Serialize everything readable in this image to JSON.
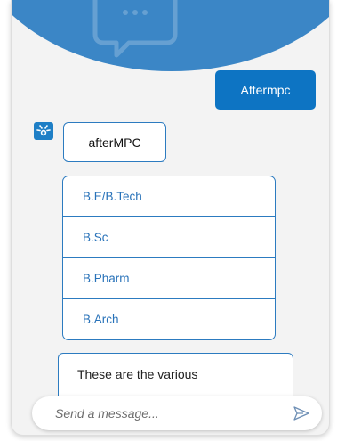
{
  "colors": {
    "header": "#3b86c6",
    "user_bubble": "#0d74c3",
    "bot_border": "#2c7bc0",
    "option_text": "#2872b9",
    "background": "#f3f3f3"
  },
  "header": {
    "icon": "chat-bubble-icon"
  },
  "messages": {
    "user_message": "Aftermpc",
    "bot_avatar_icon": "bot-icon",
    "bot_message": "afterMPC",
    "options": [
      {
        "label": "B.E/B.Tech"
      },
      {
        "label": "B.Sc"
      },
      {
        "label": "B.Pharm"
      },
      {
        "label": "B.Arch"
      }
    ],
    "bot_message_2": "These are the various"
  },
  "composer": {
    "placeholder": "Send a message...",
    "send_icon": "send-icon"
  }
}
